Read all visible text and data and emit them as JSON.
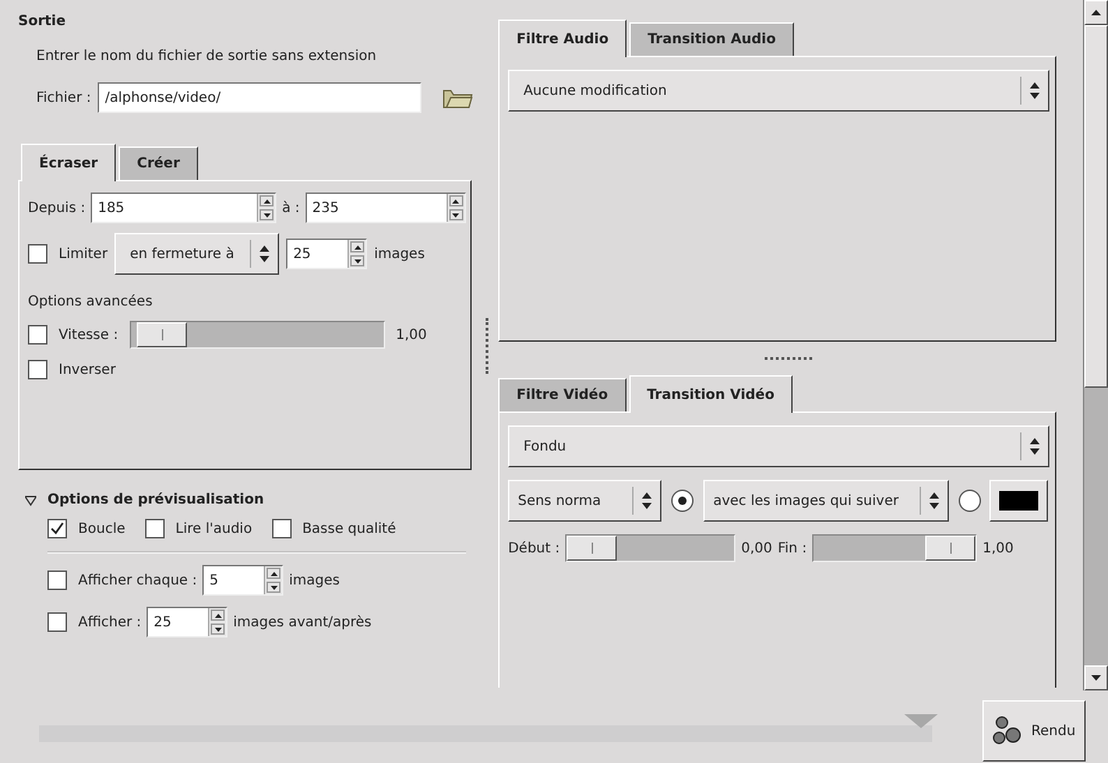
{
  "sortie": {
    "title": "Sortie",
    "hint": "Entrer le nom du fichier de sortie sans extension",
    "file_label": "Fichier :",
    "file_value": "/alphonse/video/"
  },
  "mode_tabs": [
    {
      "label": "Écraser",
      "selected": true
    },
    {
      "label": "Créer",
      "selected": false
    }
  ],
  "range": {
    "from_label": "Depuis :",
    "from_value": "185",
    "to_label": "à :",
    "to_value": "235"
  },
  "limit": {
    "label": "Limiter",
    "checked": false,
    "mode": "en fermeture à",
    "value": "25",
    "unit": "images"
  },
  "advanced": {
    "title": "Options avancées",
    "speed": {
      "label": "Vitesse :",
      "checked": false,
      "level": 0.03,
      "reading": "1,00"
    },
    "reverse": {
      "label": "Inverser",
      "checked": false
    }
  },
  "preview": {
    "title": "Options de prévisualisation",
    "expanded": true,
    "options": [
      {
        "label": "Boucle",
        "checked": true
      },
      {
        "label": "Lire l'audio",
        "checked": false
      },
      {
        "label": "Basse qualité",
        "checked": false
      }
    ],
    "show_every": {
      "label": "Afficher chaque :",
      "checked": false,
      "value": "5",
      "unit": "images"
    },
    "show_around": {
      "label": "Afficher :",
      "checked": false,
      "value": "25",
      "unit": "images avant/après"
    }
  },
  "audio_tabs": [
    {
      "label": "Filtre Audio",
      "selected": true
    },
    {
      "label": "Transition Audio",
      "selected": false
    }
  ],
  "audio_filter": "Aucune modification",
  "video_tabs": [
    {
      "label": "Filtre Vidéo",
      "selected": false
    },
    {
      "label": "Transition Vidéo",
      "selected": true
    }
  ],
  "video_transition": "Fondu",
  "direction": "Sens norma",
  "blend": [
    {
      "kind": "images",
      "selected": true,
      "option": "avec les images qui suiver"
    },
    {
      "kind": "color",
      "selected": false,
      "color": "#000000"
    }
  ],
  "start": {
    "label": "Début :",
    "level": 0,
    "reading": "0,00"
  },
  "end": {
    "label": "Fin :",
    "level": 1,
    "reading": "1,00"
  },
  "render_button": "Rendu"
}
